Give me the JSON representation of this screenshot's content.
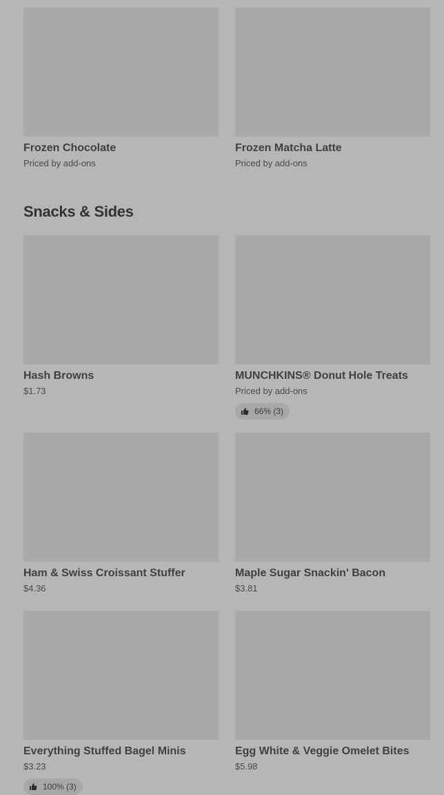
{
  "top_items": [
    {
      "name": "Frozen Chocolate",
      "price": "Priced by add-ons"
    },
    {
      "name": "Frozen Matcha Latte",
      "price": "Priced by add-ons"
    }
  ],
  "section": {
    "title": "Snacks & Sides"
  },
  "snack_items": [
    {
      "name": "Hash Browns",
      "price": "$1.73"
    },
    {
      "name": "MUNCHKINS® Donut Hole Treats",
      "price": "Priced by add-ons",
      "rating": "66% (3)"
    },
    {
      "name": "Ham & Swiss Croissant Stuffer",
      "price": "$4.36"
    },
    {
      "name": "Maple Sugar Snackin' Bacon",
      "price": "$3.81"
    },
    {
      "name": "Everything Stuffed Bagel Minis",
      "price": "$3.23",
      "rating": "100% (3)"
    },
    {
      "name": "Egg White & Veggie Omelet Bites",
      "price": "$5.98"
    }
  ],
  "icons": {
    "rating": "thumbs-up-icon"
  },
  "colors": {
    "background": "#b6b6b6",
    "placeholder": "#a9a9a9",
    "text": "#404040"
  }
}
